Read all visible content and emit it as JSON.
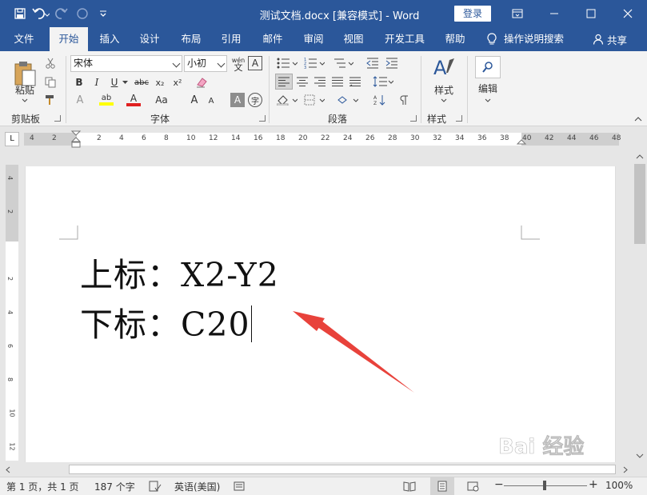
{
  "window": {
    "title": "测试文档.docx [兼容模式] - Word",
    "login_label": "登录"
  },
  "tabs": [
    {
      "label": "文件",
      "active": false
    },
    {
      "label": "开始",
      "active": true
    },
    {
      "label": "插入",
      "active": false
    },
    {
      "label": "设计",
      "active": false
    },
    {
      "label": "布局",
      "active": false
    },
    {
      "label": "引用",
      "active": false
    },
    {
      "label": "邮件",
      "active": false
    },
    {
      "label": "审阅",
      "active": false
    },
    {
      "label": "视图",
      "active": false
    },
    {
      "label": "开发工具",
      "active": false
    },
    {
      "label": "帮助",
      "active": false
    }
  ],
  "tell_me": "操作说明搜索",
  "share": "共享",
  "ribbon": {
    "clipboard": {
      "group_label": "剪贴板",
      "paste_label": "粘贴"
    },
    "font": {
      "group_label": "字体",
      "font_name": "宋体",
      "font_size": "小初",
      "wen_label": "wén",
      "wen_char": "文",
      "a_box": "A",
      "bold": "B",
      "italic": "I",
      "underline": "U",
      "strike": "abc",
      "subscript": "x₂",
      "superscript": "x²",
      "grow": "A",
      "shrink": "A",
      "case": "Aa",
      "highlight": "ab",
      "font_color": "A",
      "char_shading": "A",
      "enclose": "字"
    },
    "paragraph": {
      "group_label": "段落"
    },
    "styles": {
      "group_label": "样式",
      "button_label": "样式"
    },
    "editing": {
      "button_label": "编辑"
    }
  },
  "ruler": {
    "h_labels": [
      "4",
      "2",
      "",
      "2",
      "4",
      "6",
      "8",
      "10",
      "12",
      "14",
      "16",
      "18",
      "20",
      "22",
      "24",
      "26",
      "28",
      "30",
      "32",
      "34",
      "36",
      "38",
      "40",
      "42",
      "44",
      "46",
      "48"
    ],
    "v_labels": [
      "4",
      "2",
      "",
      "2",
      "4",
      "6",
      "8",
      "10",
      "12"
    ],
    "corner": "L"
  },
  "document": {
    "line1": "上标：X2-Y2",
    "line2": "下标：C20"
  },
  "status": {
    "page": "第 1 页，共 1 页",
    "words": "187 个字",
    "language": "英语(美国)",
    "zoom": "100%",
    "zoom_minus": "−",
    "zoom_plus": "+"
  },
  "colors": {
    "accent": "#2b579a",
    "annotation_arrow": "#e8423b",
    "highlight_yellow": "#ffff00",
    "font_red": "#e02020"
  },
  "watermark": "Bai 经验"
}
